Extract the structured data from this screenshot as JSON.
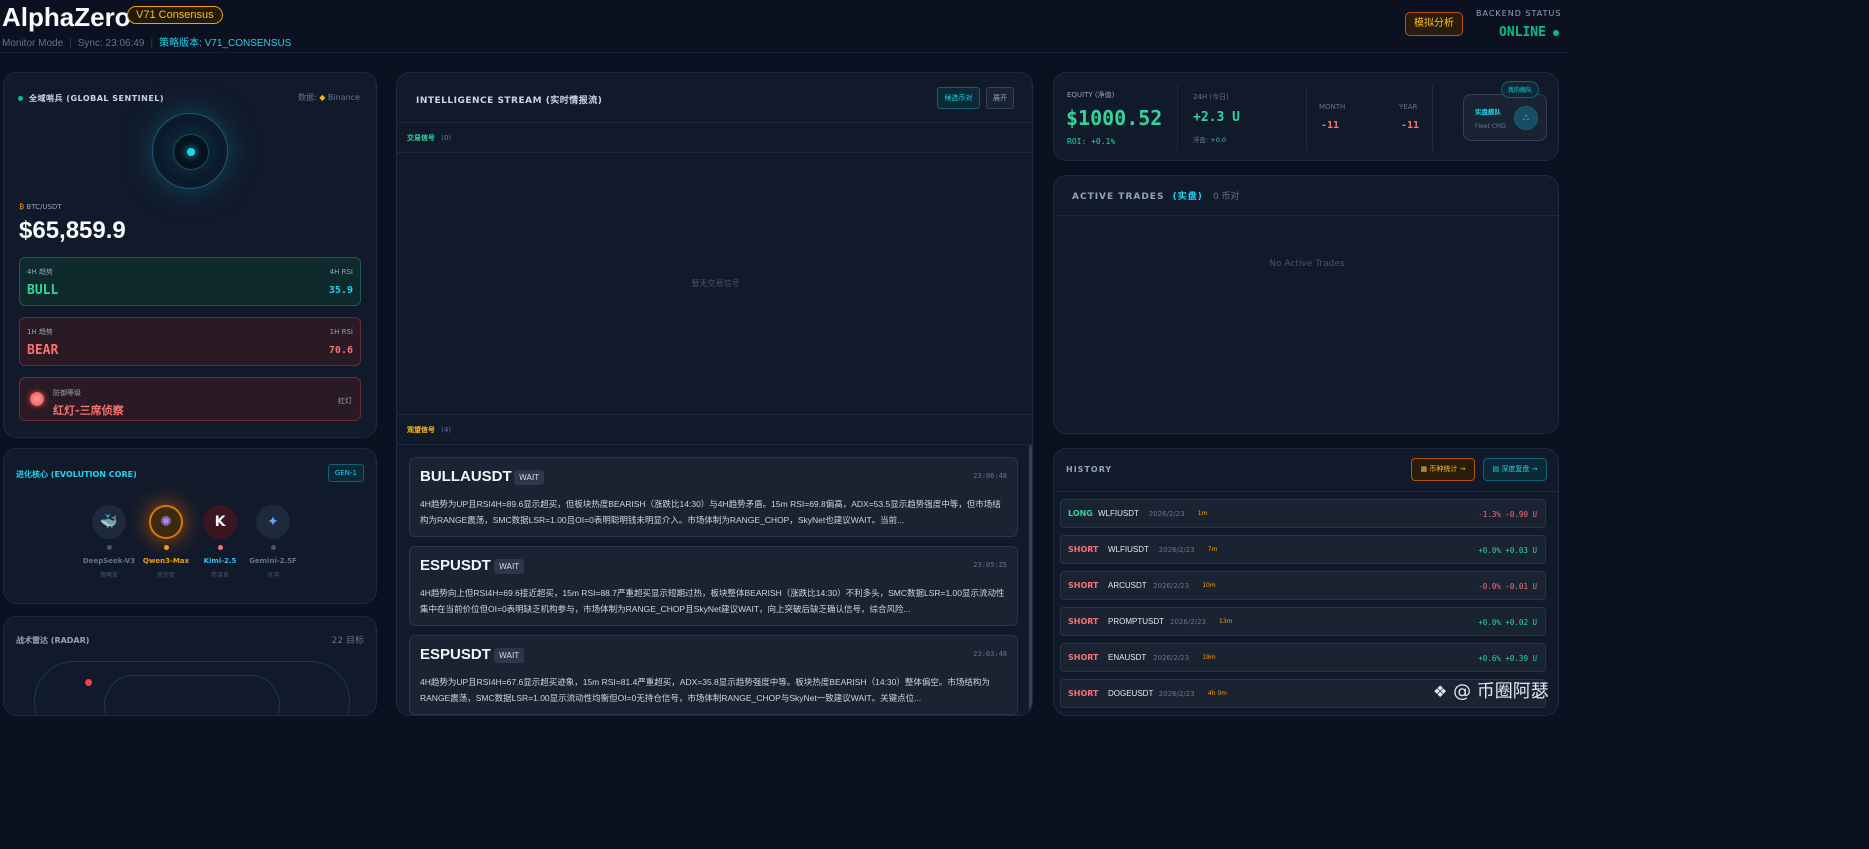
{
  "header": {
    "app_title": "AlphaZero",
    "version_badge": "V71 Consensus",
    "mode": "Monitor Mode",
    "sync": "Sync: 23:06:49",
    "strategy_label": "策略版本:",
    "strategy_value": "V71_CONSENSUS",
    "sim_button": "模拟分析",
    "backend_label": "BACKEND STATUS",
    "backend_value": "ONLINE"
  },
  "sentinel": {
    "title": "全域哨兵 (GLOBAL SENTINEL)",
    "source_label": "数据:",
    "source_value": "Binance",
    "pair": "BTC/USDT",
    "price": "$65,859.9",
    "h4_label": "4H 趋势",
    "h4_rsi_label": "4H RSI",
    "h4_value": "BULL",
    "h4_rsi": "35.9",
    "h1_label": "1H 趋势",
    "h1_rsi_label": "1H RSI",
    "h1_value": "BEAR",
    "h1_rsi": "70.6",
    "defense_label": "防御等级",
    "defense_value": "红灯-三席侦察",
    "defense_tag": "红灯"
  },
  "evolution": {
    "title": "进化核心 (EVOLUTION CORE)",
    "gen": "GEN-1",
    "models": [
      {
        "name": "DeepSeek-V3",
        "role": "策略官",
        "color": "#64748b"
      },
      {
        "name": "Qwen3-Max",
        "role": "风控官",
        "color": "#f59e0b"
      },
      {
        "name": "Kimi-2.5",
        "role": "参谋官",
        "color": "#38bdf8"
      },
      {
        "name": "Gemini-2.5F",
        "role": "对冲",
        "color": "#64748b"
      }
    ]
  },
  "radar": {
    "title": "战术雷达 (RADAR)",
    "count": "22 目标"
  },
  "stream": {
    "title": "INTELLIGENCE STREAM (实时情报流)",
    "btn_candidates": "候选币对",
    "btn_expand": "展开",
    "trade_signals_label": "交易信号",
    "trade_signals_count": "(0)",
    "empty_text": "暂无交易信号",
    "watch_signals_label": "观望信号",
    "watch_signals_count": "(4)",
    "signals": [
      {
        "symbol": "BULLAUSDT",
        "action": "WAIT",
        "time": "23:06:48",
        "text": "4H趋势为UP且RSI4H=89.6显示超买，但板块热度BEARISH（涨跌比14:30）与4H趋势矛盾。15m RSI=69.8偏高，ADX=53.5显示趋势强度中等，但市场结构为RANGE震荡，SMC数据LSR=1.00且OI=0表明聪明钱未明显介入。市场体制为RANGE_CHOP，SkyNet也建议WAIT。当前..."
      },
      {
        "symbol": "ESPUSDT",
        "action": "WAIT",
        "time": "23:05:25",
        "text": "4H趋势向上但RSI4H=69.6接近超买，15m RSI=88.7严重超买显示短期过热，板块整体BEARISH（涨跌比14:30）不利多头，SMC数据LSR=1.00显示流动性集中在当前价位但OI=0表明缺乏机构参与，市场体制为RANGE_CHOP且SkyNet建议WAIT，向上突破后缺乏确认信号，综合风险..."
      },
      {
        "symbol": "ESPUSDT",
        "action": "WAIT",
        "time": "23:03:48",
        "text": "4H趋势为UP且RSI4H=67.6显示超买迹象，15m RSI=81.4严重超买，ADX=35.8显示趋势强度中等。板块热度BEARISH（14:30）整体偏空。市场结构为RANGE震荡，SMC数据LSR=1.00显示流动性均衡但OI=0无持仓信号，市场体制RANGE_CHOP与SkyNet一致建议WAIT。关键点位..."
      }
    ]
  },
  "equity": {
    "label": "EQUITY (净值)",
    "value": "$1000.52",
    "roi": "ROI: +0.1%",
    "h24_label": "24H (今日)",
    "h24_value": "+2.3 U",
    "float_label": "浮盈:",
    "float_value": "+0.0",
    "month_label": "MONTH",
    "month_value": "-11",
    "year_label": "YEAR",
    "year_value": "-11",
    "fleet_badge": "我的舰队",
    "fleet_title": "实盘舰队",
    "fleet_sub": "Fleet CMD"
  },
  "active_trades": {
    "title": "ACTIVE TRADES",
    "mode": "(实盘)",
    "count": "0 币对",
    "empty": "No Active Trades"
  },
  "history": {
    "title": "HISTORY",
    "btn_stats": "币种统计 →",
    "btn_review": "深度复盘 →",
    "rows": [
      {
        "side": "LONG",
        "symbol": "WLFIUSDT",
        "date": "2026/2/23",
        "dur": "1m",
        "pnl": "-1.3%  -0.90 U",
        "up": false
      },
      {
        "side": "SHORT",
        "symbol": "WLFIUSDT",
        "date": "2026/2/23",
        "dur": "7m",
        "pnl": "+0.0%  +0.03 U",
        "up": true
      },
      {
        "side": "SHORT",
        "symbol": "ARCUSDT",
        "date": "2026/2/23",
        "dur": "10m",
        "pnl": "-0.0%  -0.01 U",
        "up": false
      },
      {
        "side": "SHORT",
        "symbol": "PROMPTUSDT",
        "date": "2026/2/23",
        "dur": "13m",
        "pnl": "+0.0%  +0.02 U",
        "up": true
      },
      {
        "side": "SHORT",
        "symbol": "ENAUSDT",
        "date": "2026/2/23",
        "dur": "19m",
        "pnl": "+0.6%  +0.39 U",
        "up": true
      },
      {
        "side": "SHORT",
        "symbol": "DOGEUSDT",
        "date": "2026/2/23",
        "dur": "4h 0m",
        "pnl": "",
        "up": true
      }
    ]
  },
  "watermark": "@ 币圈阿瑟"
}
